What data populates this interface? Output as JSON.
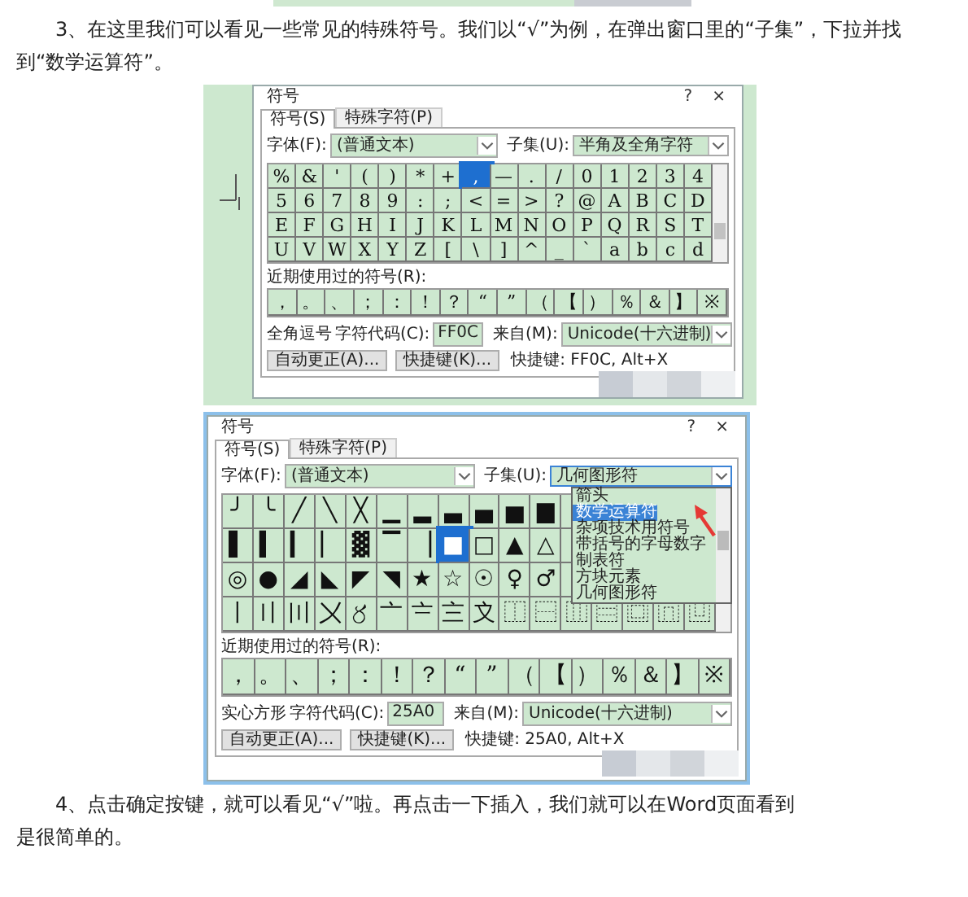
{
  "step_3": {
    "text": "3、在这里我们可以看见一些常见的特殊符号。我们以“√”为例，在弹出窗口里的“子集”，下拉并找到“数学运算符”。"
  },
  "figures": [
    {
      "backdrop": true,
      "dialog": {
        "title": "符号",
        "help": "?",
        "close": "×",
        "tabs": [
          {
            "label": "符号(S)",
            "selected": true
          },
          {
            "label": "特殊字符(P)",
            "selected": false
          }
        ],
        "font_label": "字体(F):",
        "font_value": "(普通文本)",
        "subset_label": "子集(U):",
        "subset_value": "半角及全角字符",
        "grid": [
          [
            {
              "c": "%",
              "selected": false
            },
            {
              "c": "&",
              "selected": false
            },
            {
              "c": "'",
              "selected": false
            },
            {
              "c": "(",
              "selected": false
            },
            {
              "c": ")",
              "selected": false
            },
            {
              "c": "*",
              "selected": false
            },
            {
              "c": "+",
              "selected": false
            },
            {
              "c": ",",
              "selected": true
            },
            {
              "c": "—",
              "selected": false
            },
            {
              "c": ".",
              "selected": false
            },
            {
              "c": "/",
              "selected": false
            },
            {
              "c": "0",
              "selected": false
            },
            {
              "c": "1",
              "selected": false
            },
            {
              "c": "2",
              "selected": false
            },
            {
              "c": "3",
              "selected": false
            },
            {
              "c": "4",
              "selected": false
            }
          ],
          [
            {
              "c": "5",
              "selected": false
            },
            {
              "c": "6",
              "selected": false
            },
            {
              "c": "7",
              "selected": false
            },
            {
              "c": "8",
              "selected": false
            },
            {
              "c": "9",
              "selected": false
            },
            {
              "c": ":",
              "selected": false
            },
            {
              "c": ";",
              "selected": false
            },
            {
              "c": "<",
              "selected": false
            },
            {
              "c": "=",
              "selected": false
            },
            {
              "c": ">",
              "selected": false
            },
            {
              "c": "?",
              "selected": false
            },
            {
              "c": "@",
              "selected": false
            },
            {
              "c": "A",
              "selected": false
            },
            {
              "c": "B",
              "selected": false
            },
            {
              "c": "C",
              "selected": false
            },
            {
              "c": "D",
              "selected": false
            }
          ],
          [
            {
              "c": "E",
              "selected": false
            },
            {
              "c": "F",
              "selected": false
            },
            {
              "c": "G",
              "selected": false
            },
            {
              "c": "H",
              "selected": false
            },
            {
              "c": "I",
              "selected": false
            },
            {
              "c": "J",
              "selected": false
            },
            {
              "c": "K",
              "selected": false
            },
            {
              "c": "L",
              "selected": false
            },
            {
              "c": "M",
              "selected": false
            },
            {
              "c": "N",
              "selected": false
            },
            {
              "c": "O",
              "selected": false
            },
            {
              "c": "P",
              "selected": false
            },
            {
              "c": "Q",
              "selected": false
            },
            {
              "c": "R",
              "selected": false
            },
            {
              "c": "S",
              "selected": false
            },
            {
              "c": "T",
              "selected": false
            }
          ],
          [
            {
              "c": "U",
              "selected": false
            },
            {
              "c": "V",
              "selected": false
            },
            {
              "c": "W",
              "selected": false
            },
            {
              "c": "X",
              "selected": false
            },
            {
              "c": "Y",
              "selected": false
            },
            {
              "c": "Z",
              "selected": false
            },
            {
              "c": "[",
              "selected": false
            },
            {
              "c": "\\",
              "selected": false
            },
            {
              "c": "]",
              "selected": false
            },
            {
              "c": "^",
              "selected": false
            },
            {
              "c": "_",
              "selected": false
            },
            {
              "c": "`",
              "selected": false
            },
            {
              "c": "a",
              "selected": false
            },
            {
              "c": "b",
              "selected": false
            },
            {
              "c": "c",
              "selected": false
            },
            {
              "c": "d",
              "selected": false
            }
          ]
        ],
        "recent_label": "近期使用过的符号(R):",
        "recent": [
          "，",
          "。",
          "、",
          "；",
          "：",
          "！",
          "？",
          "“",
          "”",
          "（",
          "【",
          "）",
          "％",
          "＆",
          "】",
          "※"
        ],
        "char_name": "全角逗号",
        "code_label": "字符代码(C):",
        "code_value": "FF0C",
        "from_label": "来自(M):",
        "from_value": "Unicode(十六进制)",
        "buttons": [
          "自动更正(A)...",
          "快捷键(K)..."
        ],
        "shortcut": "快捷键: FF0C, Alt+X"
      }
    },
    {
      "backdrop": false,
      "dialog": {
        "title": "符号",
        "help": "?",
        "close": "×",
        "tabs": [
          {
            "label": "符号(S)",
            "selected": true
          },
          {
            "label": "特殊字符(P)",
            "selected": false
          }
        ],
        "font_label": "字体(F):",
        "font_value": "(普通文本)",
        "subset_label": "子集(U):",
        "subset_value": "几何图形符",
        "subset_list": [
          {
            "label": "箭头",
            "selected": false
          },
          {
            "label": "数学运算符",
            "selected": true
          },
          {
            "label": "杂项技术用符号",
            "selected": false
          },
          {
            "label": "带括号的字母数字",
            "selected": false
          },
          {
            "label": "制表符",
            "selected": false
          },
          {
            "label": "方块元素",
            "selected": false
          },
          {
            "label": "几何图形符",
            "selected": false
          }
        ],
        "grid": [
          [
            {
              "c": "╯",
              "selected": false
            },
            {
              "c": "╰",
              "selected": false
            },
            {
              "c": "╱",
              "selected": false
            },
            {
              "c": "╲",
              "selected": false
            },
            {
              "c": "╳",
              "selected": false
            },
            {
              "c": "▁",
              "selected": false
            },
            {
              "c": "▂",
              "selected": false
            },
            {
              "c": "▃",
              "selected": false
            },
            {
              "c": "▄",
              "selected": false
            },
            {
              "c": "▅",
              "selected": false
            },
            {
              "c": "▆",
              "selected": false
            }
          ],
          [
            {
              "c": "▌",
              "selected": false
            },
            {
              "c": "▍",
              "selected": false
            },
            {
              "c": "▎",
              "selected": false
            },
            {
              "c": "▏",
              "selected": false
            },
            {
              "c": "▓",
              "selected": false
            },
            {
              "c": "▔",
              "selected": false
            },
            {
              "c": "▕",
              "selected": false
            },
            {
              "c": "■",
              "selected": true
            },
            {
              "c": "□",
              "selected": false
            },
            {
              "c": "▲",
              "selected": false
            },
            {
              "c": "△",
              "selected": false
            }
          ],
          [
            {
              "c": "◎",
              "selected": false
            },
            {
              "c": "●",
              "selected": false
            },
            {
              "c": "◢",
              "selected": false
            },
            {
              "c": "◣",
              "selected": false
            },
            {
              "c": "◤",
              "selected": false
            },
            {
              "c": "◥",
              "selected": false
            },
            {
              "c": "★",
              "selected": false
            },
            {
              "c": "☆",
              "selected": false
            },
            {
              "c": "☉",
              "selected": false
            },
            {
              "c": "♀",
              "selected": false
            },
            {
              "c": "♂",
              "selected": false
            }
          ],
          [
            {
              "c": "〡",
              "selected": false
            },
            {
              "c": "〢",
              "selected": false
            },
            {
              "c": "〣",
              "selected": false
            },
            {
              "c": "〤",
              "selected": false
            },
            {
              "c": "〥",
              "selected": false
            },
            {
              "c": "〦",
              "selected": false
            },
            {
              "c": "〧",
              "selected": false
            },
            {
              "c": "〨",
              "selected": false
            },
            {
              "c": "〩",
              "selected": false
            },
            {
              "c": "⿰",
              "selected": false
            },
            {
              "c": "⿱",
              "selected": false
            },
            {
              "c": "⿲",
              "selected": false
            },
            {
              "c": "⿳",
              "selected": false
            },
            {
              "c": "⿴",
              "selected": false
            },
            {
              "c": "⿵",
              "selected": false
            },
            {
              "c": "⿶",
              "selected": false
            }
          ]
        ],
        "recent_label": "近期使用过的符号(R):",
        "recent": [
          "，",
          "。",
          "、",
          "；",
          "：",
          "！",
          "？",
          "“",
          "”",
          "（",
          "【",
          "）",
          "％",
          "＆",
          "】",
          "※"
        ],
        "char_name": "实心方形",
        "code_label": "字符代码(C):",
        "code_value": "25A0",
        "from_label": "来自(M):",
        "from_value": "Unicode(十六进制)",
        "buttons": [
          "自动更正(A)...",
          "快捷键(K)..."
        ],
        "shortcut": "快捷键: 25A0, Alt+X"
      }
    }
  ],
  "step_4": {
    "lines": [
      "4、点击确定按键，就可以看见“√”啦。再点击一下插入，我们就可以在Word页面看到",
      "是很简单的。"
    ]
  }
}
